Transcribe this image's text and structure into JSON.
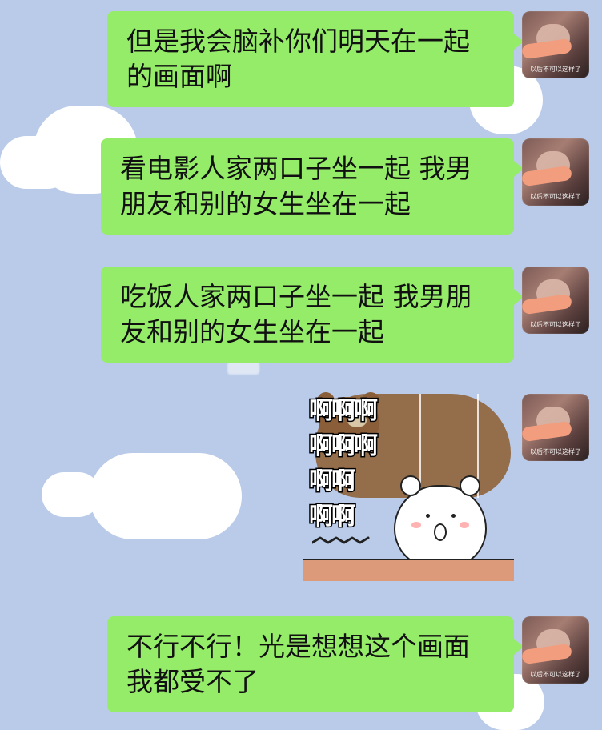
{
  "messages": [
    {
      "lines": [
        "但是我会脑补你们明天在一起",
        "的画面啊"
      ]
    },
    {
      "lines": [
        "看电影人家两口子坐一起 我男",
        "朋友和别的女生坐在一起"
      ]
    },
    {
      "lines": [
        "吃饭人家两口子坐一起 我男朋",
        "友和别的女生坐在一起"
      ]
    },
    {
      "lines": [
        "不行不行！光是想想这个画面",
        "我都受不了"
      ]
    }
  ],
  "avatar": {
    "caption": "以后不可以这样了"
  },
  "sticker": {
    "text_lines": [
      "啊啊啊",
      "啊啊啊",
      "啊啊",
      "啊啊"
    ]
  }
}
